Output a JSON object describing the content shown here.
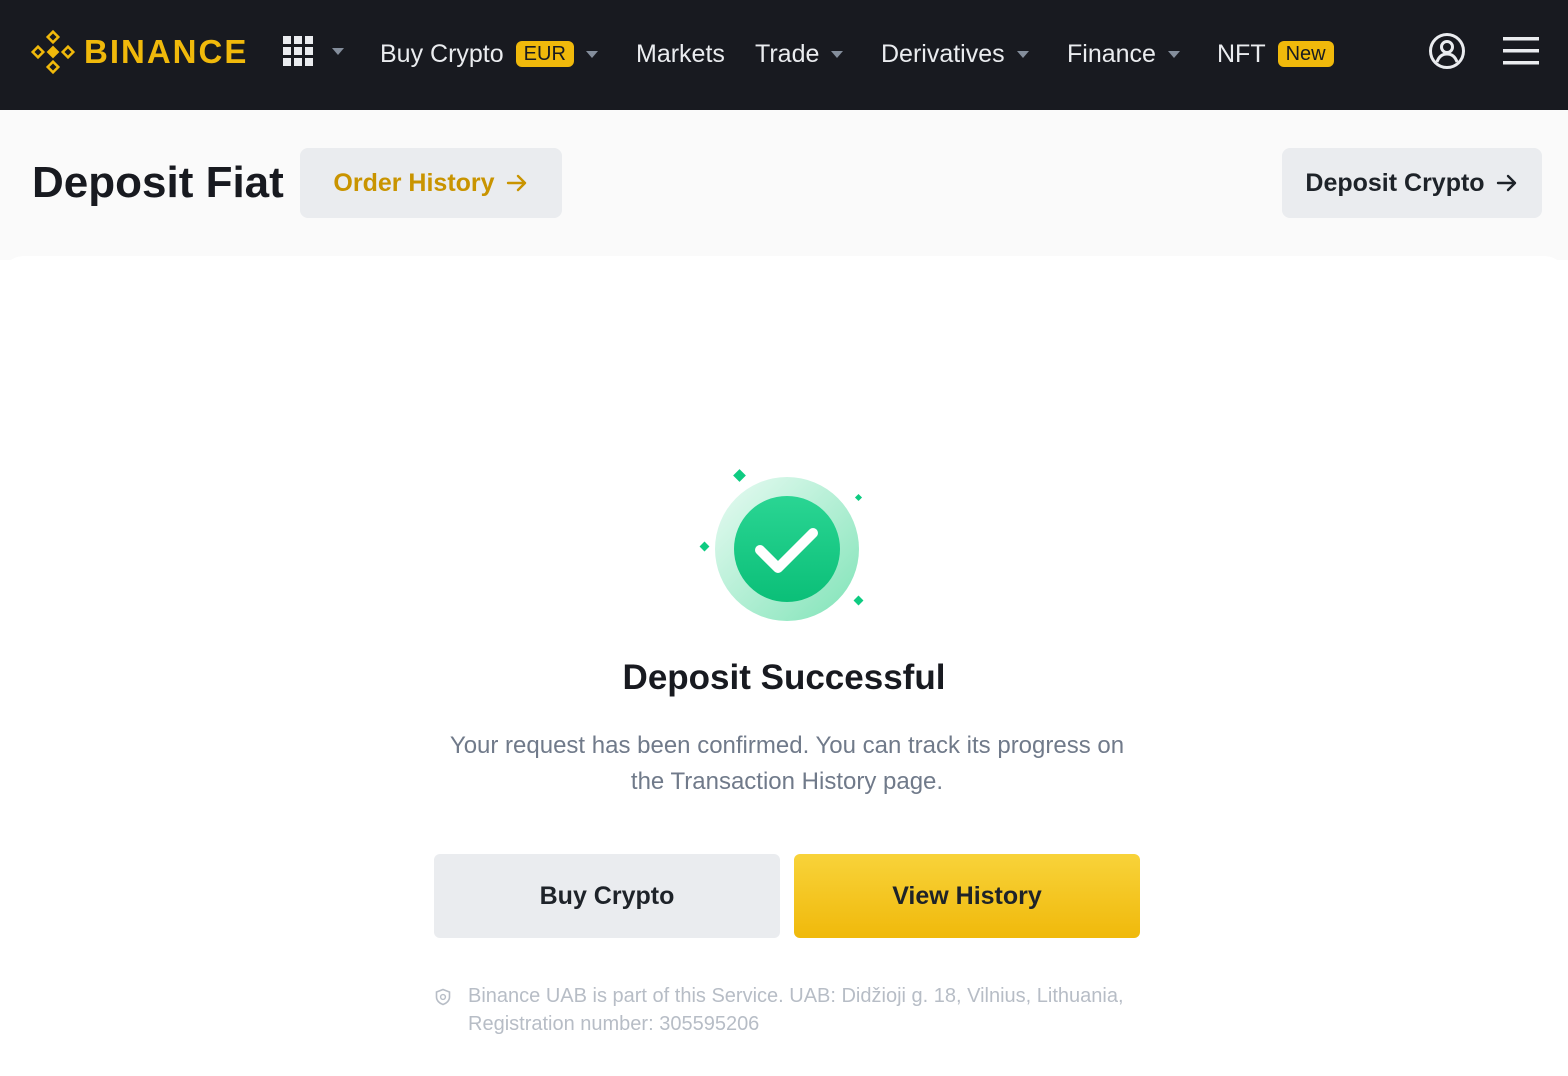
{
  "brand": {
    "name": "BINANCE",
    "color": "#f0b90b"
  },
  "nav": {
    "apps_icon": "grid-icon",
    "items": [
      {
        "label": "Buy Crypto",
        "badge": "EUR",
        "dropdown": true
      },
      {
        "label": "Markets",
        "dropdown": false
      },
      {
        "label": "Trade",
        "dropdown": true
      },
      {
        "label": "Derivatives",
        "dropdown": true
      },
      {
        "label": "Finance",
        "dropdown": true
      },
      {
        "label": "NFT",
        "badge": "New",
        "dropdown": false
      }
    ],
    "user_icon": "user-icon",
    "menu_icon": "hamburger-menu-icon"
  },
  "header": {
    "title": "Deposit Fiat",
    "order_history_label": "Order History",
    "deposit_crypto_label": "Deposit Crypto"
  },
  "result": {
    "icon": "success-check-icon",
    "accent": "#0ecb81",
    "title": "Deposit Successful",
    "description": "Your request has been confirmed. You can track its progress on the Transaction History page.",
    "buy_crypto_label": "Buy Crypto",
    "view_history_label": "View History"
  },
  "footer": {
    "shield_icon": "shield-icon",
    "note": "Binance UAB is part of this Service. UAB: Didžioji g. 18, Vilnius, Lithuania, Registration number: 305595206"
  }
}
